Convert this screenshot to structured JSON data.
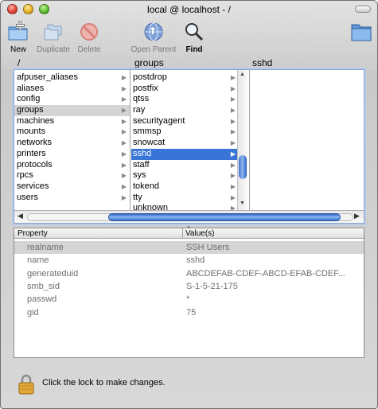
{
  "window": {
    "title": "local @ localhost - /"
  },
  "toolbar": {
    "new_label": "New",
    "duplicate_label": "Duplicate",
    "delete_label": "Delete",
    "open_parent_label": "Open Parent",
    "find_label": "Find"
  },
  "browser": {
    "col1_header": "/",
    "col2_header": "groups",
    "col3_header": "sshd",
    "col1_items": [
      "afpuser_aliases",
      "aliases",
      "config",
      "groups",
      "machines",
      "mounts",
      "networks",
      "printers",
      "protocols",
      "rpcs",
      "services",
      "users"
    ],
    "col1_selected": "groups",
    "col2_items": [
      "postdrop",
      "postfix",
      "qtss",
      "ray",
      "securityagent",
      "smmsp",
      "snowcat",
      "sshd",
      "staff",
      "sys",
      "tokend",
      "tty",
      "unknown"
    ],
    "col2_selected": "sshd"
  },
  "table": {
    "header_property": "Property",
    "header_values": "Value(s)",
    "rows": [
      {
        "property": "realname",
        "value": "SSH Users"
      },
      {
        "property": "name",
        "value": "sshd"
      },
      {
        "property": "generateduid",
        "value": "ABCDEFAB-CDEF-ABCD-EFAB-CDEF..."
      },
      {
        "property": "smb_sid",
        "value": "S-1-5-21-175"
      },
      {
        "property": "passwd",
        "value": "*"
      },
      {
        "property": "gid",
        "value": "75"
      }
    ]
  },
  "status": {
    "lock_text": "Click the lock to make changes."
  },
  "colors": {
    "selection_blue": "#3875d7",
    "selection_gray": "#d4d4d4"
  }
}
